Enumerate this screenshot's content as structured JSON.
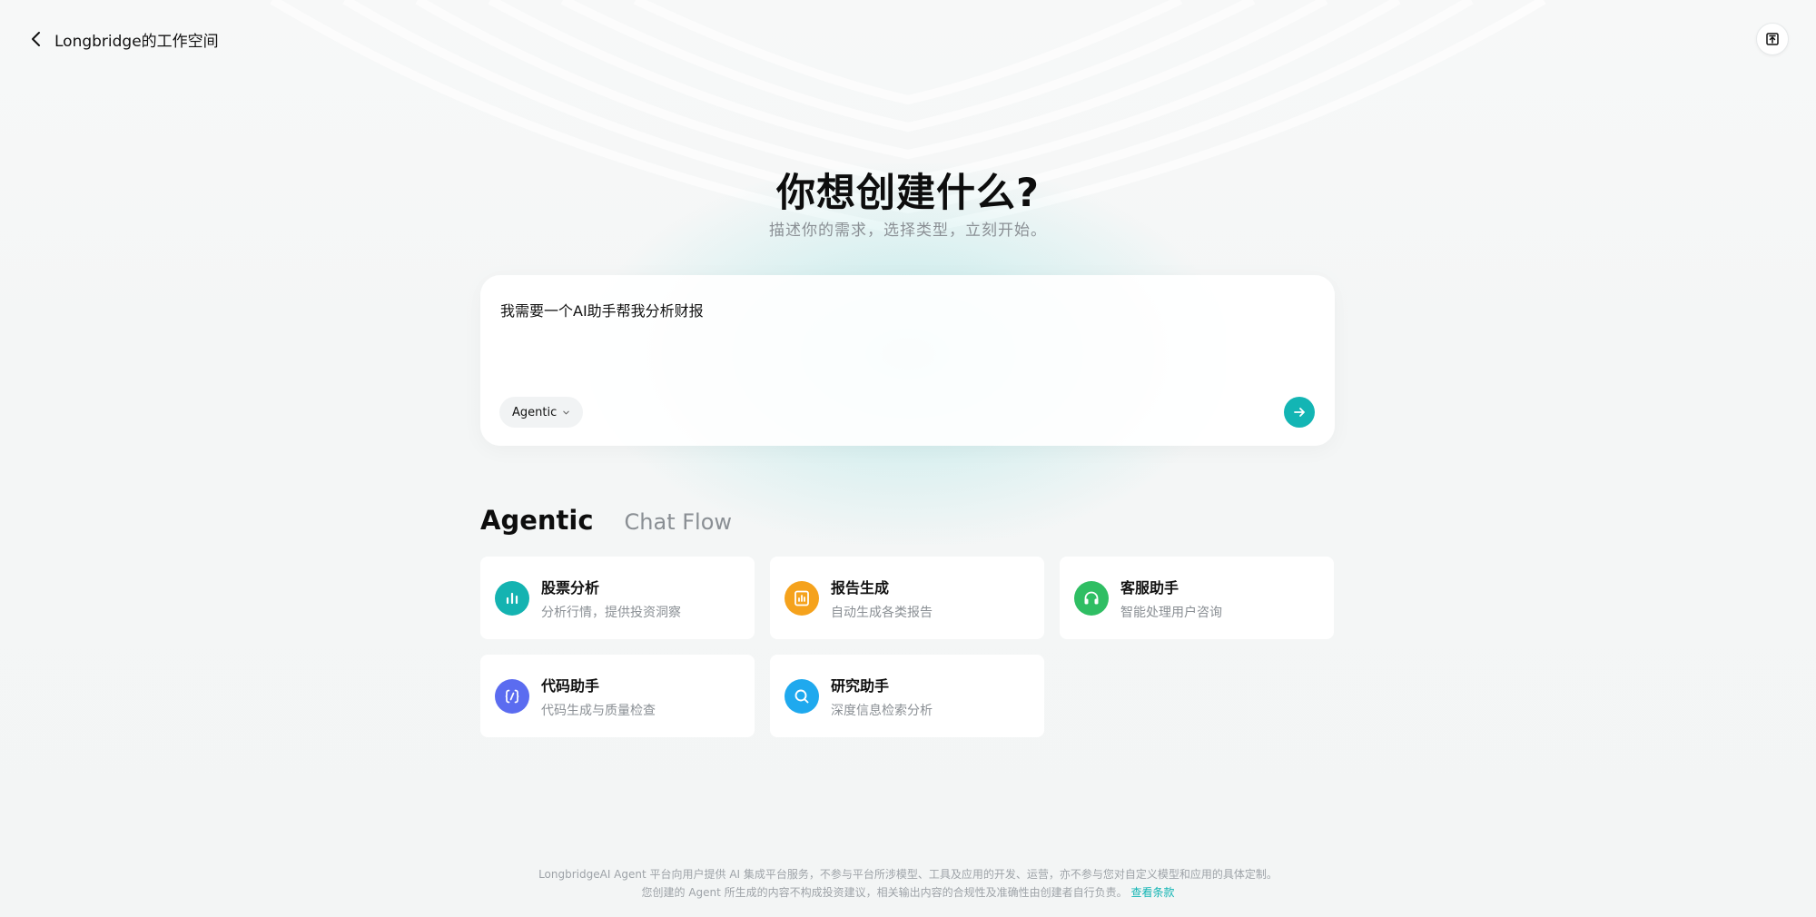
{
  "header": {
    "back_label": "Longbridge的工作空间"
  },
  "hero": {
    "title": "你想创建什么?",
    "subtitle": "描述你的需求，选择类型，立刻开始。"
  },
  "prompt": {
    "value": "我需要一个AI助手帮我分析财报",
    "mode": "Agentic"
  },
  "tabs": [
    {
      "label": "Agentic",
      "active": true
    },
    {
      "label": "Chat Flow",
      "active": false
    }
  ],
  "cards": [
    {
      "title": "股票分析",
      "desc": "分析行情，提供投资洞察",
      "icon": "bar-chart-icon",
      "color": "#14b3b1"
    },
    {
      "title": "报告生成",
      "desc": "自动生成各类报告",
      "icon": "report-icon",
      "color": "#f5a21c"
    },
    {
      "title": "客服助手",
      "desc": "智能处理用户咨询",
      "icon": "headset-icon",
      "color": "#2fbe63"
    },
    {
      "title": "代码助手",
      "desc": "代码生成与质量检查",
      "icon": "code-icon",
      "color": "#5b6cf0"
    },
    {
      "title": "研究助手",
      "desc": "深度信息检索分析",
      "icon": "search-icon",
      "color": "#1fa9ee"
    }
  ],
  "footer": {
    "line1": "LongbridgeAI Agent 平台向用户提供 AI 集成平台服务，不参与平台所涉模型、工具及应用的开发、运营，亦不参与您对自定义模型和应用的具体定制。",
    "line2": "您创建的 Agent 所生成的内容不构成投资建议，相关输出内容的合规性及准确性由创建者自行负责。",
    "link": "查看条款"
  }
}
